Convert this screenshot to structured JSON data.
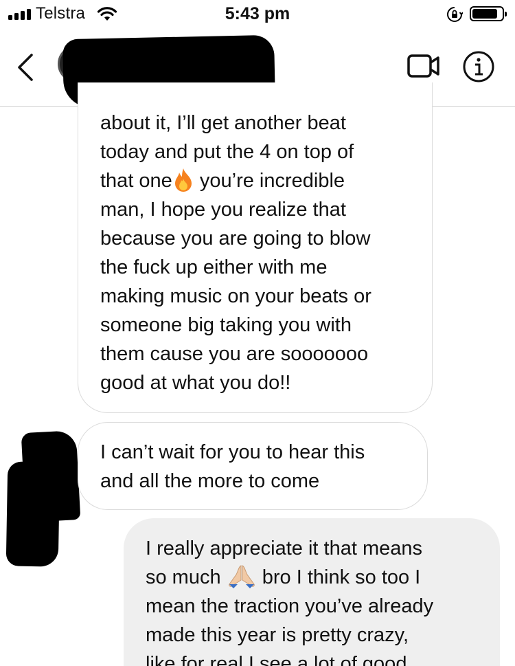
{
  "status_bar": {
    "carrier": "Telstra",
    "time": "5:43 pm",
    "signal_bars": 4,
    "battery_level": 0.85
  },
  "header": {
    "contact_name_redacted": true,
    "icons": [
      "back-chevron-icon",
      "video-call-icon",
      "info-icon"
    ]
  },
  "messages": [
    {
      "direction": "incoming",
      "text_before_emoji": "about it, I’ll get another beat\ntoday and put the 4 on top of\nthat one",
      "emoji": "🔥",
      "text_after_emoji": " you’re incredible\nman, I hope you realize that\nbecause you are going to blow\nthe fuck up either with me\nmaking music on your beats or\nsomeone big taking you with\nthem cause you are sooooooo\ngood at what you do!!"
    },
    {
      "direction": "incoming",
      "text": "I can’t wait for you to hear this\nand all the more to come"
    },
    {
      "direction": "outgoing",
      "text_before_emoji": "I really appreciate it that means\nso much ",
      "emoji": "🙏",
      "text_after_emoji": " bro I think so too I\nmean the traction you’ve already\nmade this year is pretty crazy,\nlike for real I see a lot of good"
    }
  ],
  "colors": {
    "incoming_bubble": "#ffffff",
    "incoming_border": "#dbdbdb",
    "outgoing_bubble": "#efefef",
    "redaction": "#000000",
    "fire_emoji": "#f6821f",
    "pray_emoji": "#f1c9a5"
  }
}
